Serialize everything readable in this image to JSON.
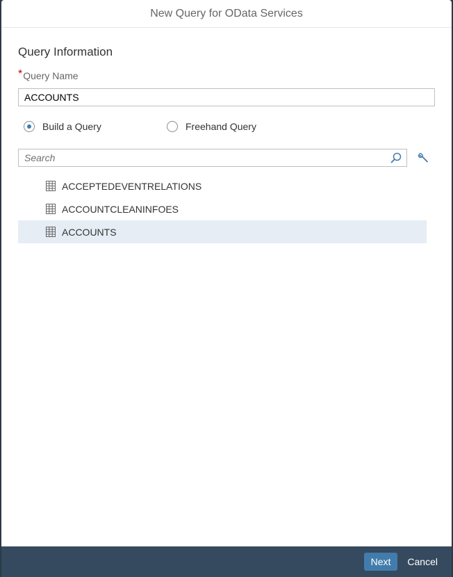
{
  "dialog": {
    "title": "New Query for OData Services"
  },
  "form": {
    "section_title": "Query Information",
    "query_name_label": "Query Name",
    "required_marker": "*",
    "query_name_value": "ACCOUNTS"
  },
  "mode": {
    "options": [
      {
        "label": "Build a Query",
        "selected": true
      },
      {
        "label": "Freehand Query",
        "selected": false
      }
    ]
  },
  "search": {
    "placeholder": "Search",
    "value": ""
  },
  "entities": [
    {
      "label": "ACCEPTEDEVENTRELATIONS",
      "icon": "table-icon",
      "selected": false
    },
    {
      "label": "ACCOUNTCLEANINFOES",
      "icon": "table-icon",
      "selected": false
    },
    {
      "label": "ACCOUNTS",
      "icon": "table-icon",
      "selected": true
    }
  ],
  "footer": {
    "next_label": "Next",
    "cancel_label": "Cancel"
  },
  "colors": {
    "accent": "#427cac",
    "footer_bg": "#354a5f",
    "selected_row": "#e6edf5",
    "required": "#bb0000"
  }
}
